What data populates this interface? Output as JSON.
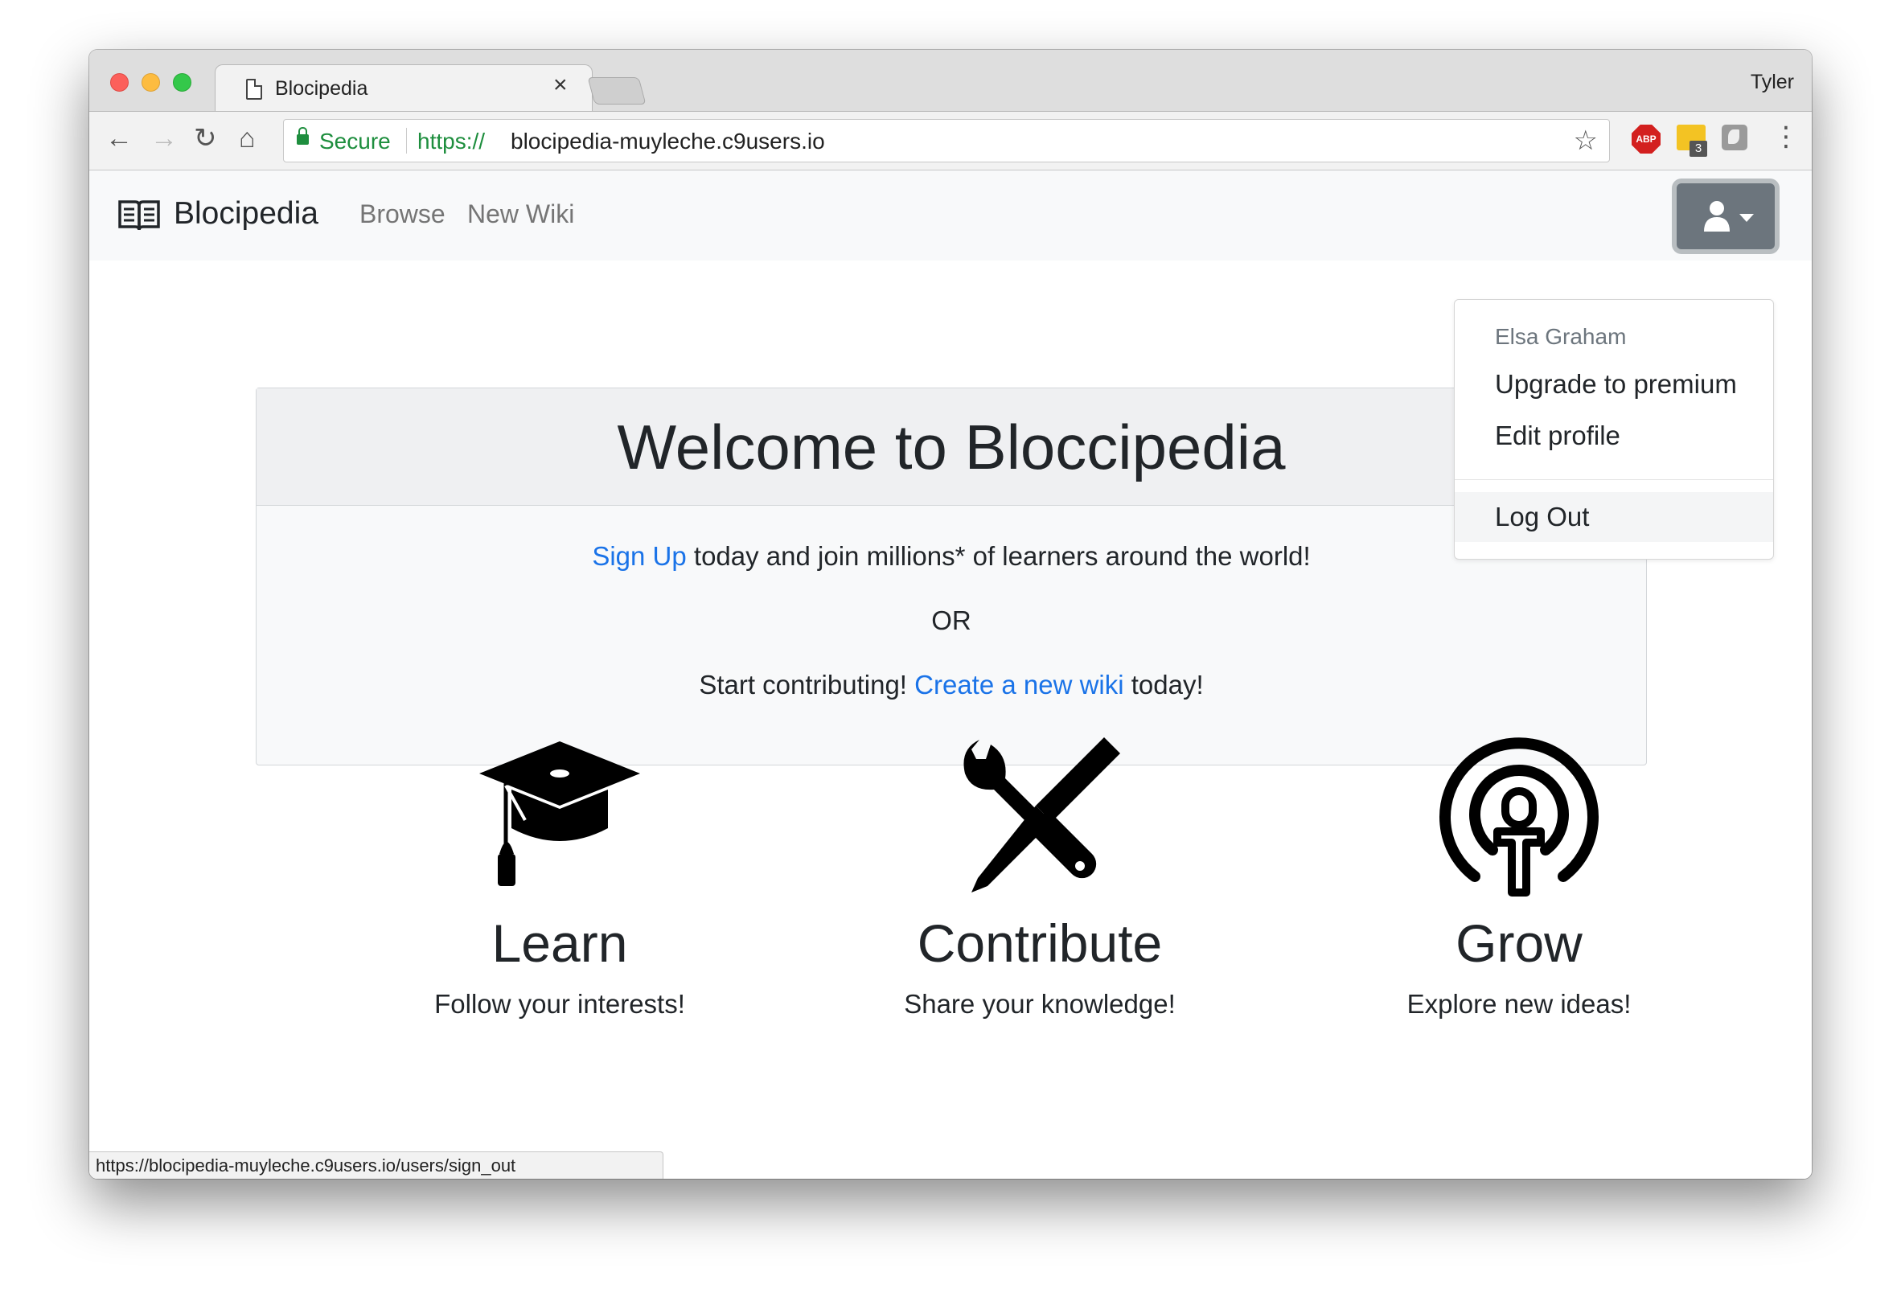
{
  "browser": {
    "tab_title": "Blocipedia",
    "tab_close": "×",
    "profile_name": "Tyler",
    "secure_label": "Secure",
    "url_scheme": "https://",
    "url_host": "blocipedia-muyleche.c9users.io",
    "abp_label": "ABP",
    "ext_badge": "3",
    "status_url": "https://blocipedia-muyleche.c9users.io/users/sign_out",
    "icons": {
      "back": "←",
      "forward": "→",
      "reload": "↻",
      "home": "⌂",
      "star": "☆",
      "menu": "⋮"
    }
  },
  "navbar": {
    "brand": "Blocipedia",
    "links": [
      "Browse",
      "New Wiki"
    ]
  },
  "dropdown": {
    "header": "Elsa Graham",
    "items": [
      "Upgrade to premium",
      "Edit profile"
    ],
    "logout": "Log Out"
  },
  "jumbotron": {
    "title": "Welcome to Bloccipedia",
    "signup_link": "Sign Up",
    "signup_rest": " today and join millions* of learners around the world!",
    "or": "OR",
    "contrib_pre": "Start contributing! ",
    "contrib_link": "Create a new wiki",
    "contrib_post": " today!"
  },
  "features": [
    {
      "title": "Learn",
      "subtitle": "Follow your interests!",
      "icon": "graduation-cap-icon"
    },
    {
      "title": "Contribute",
      "subtitle": "Share your knowledge!",
      "icon": "tools-icon"
    },
    {
      "title": "Grow",
      "subtitle": "Explore new ideas!",
      "icon": "podcast-icon"
    }
  ],
  "colors": {
    "link": "#1a73e8",
    "secure_green": "#1e8e3e",
    "user_button": "#6c757d"
  }
}
